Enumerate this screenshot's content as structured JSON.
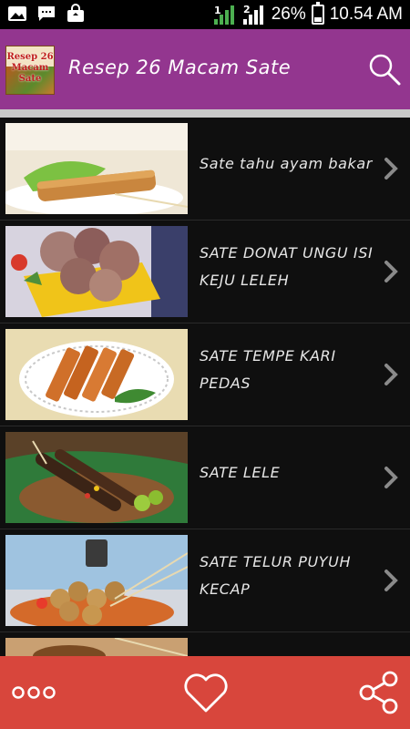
{
  "status_bar": {
    "battery": "26%",
    "time": "10.54 AM",
    "battery_level": 0.26,
    "icons": [
      "image-icon",
      "message-icon",
      "shopping-bag-icon",
      "signal-1-icon",
      "signal-2-icon",
      "battery-icon"
    ],
    "sim_1": "1",
    "sim_2": "2"
  },
  "app_bar": {
    "title": "Resep 26 Macam Sate",
    "logo_text": "Resep 26 Macam Sate",
    "background": "#93368f"
  },
  "recipes": [
    {
      "label": "Sate tahu ayam bakar"
    },
    {
      "label": "SATE DONAT UNGU ISI KEJU LELEH"
    },
    {
      "label": "SATE TEMPE KARI PEDAS"
    },
    {
      "label": "SATE LELE"
    },
    {
      "label": "SATE TELUR PUYUH KECAP"
    },
    {
      "label": ""
    }
  ],
  "bottom_bar": {
    "background": "#d8463c",
    "icons": [
      "more-icon",
      "heart-icon",
      "share-icon"
    ]
  }
}
